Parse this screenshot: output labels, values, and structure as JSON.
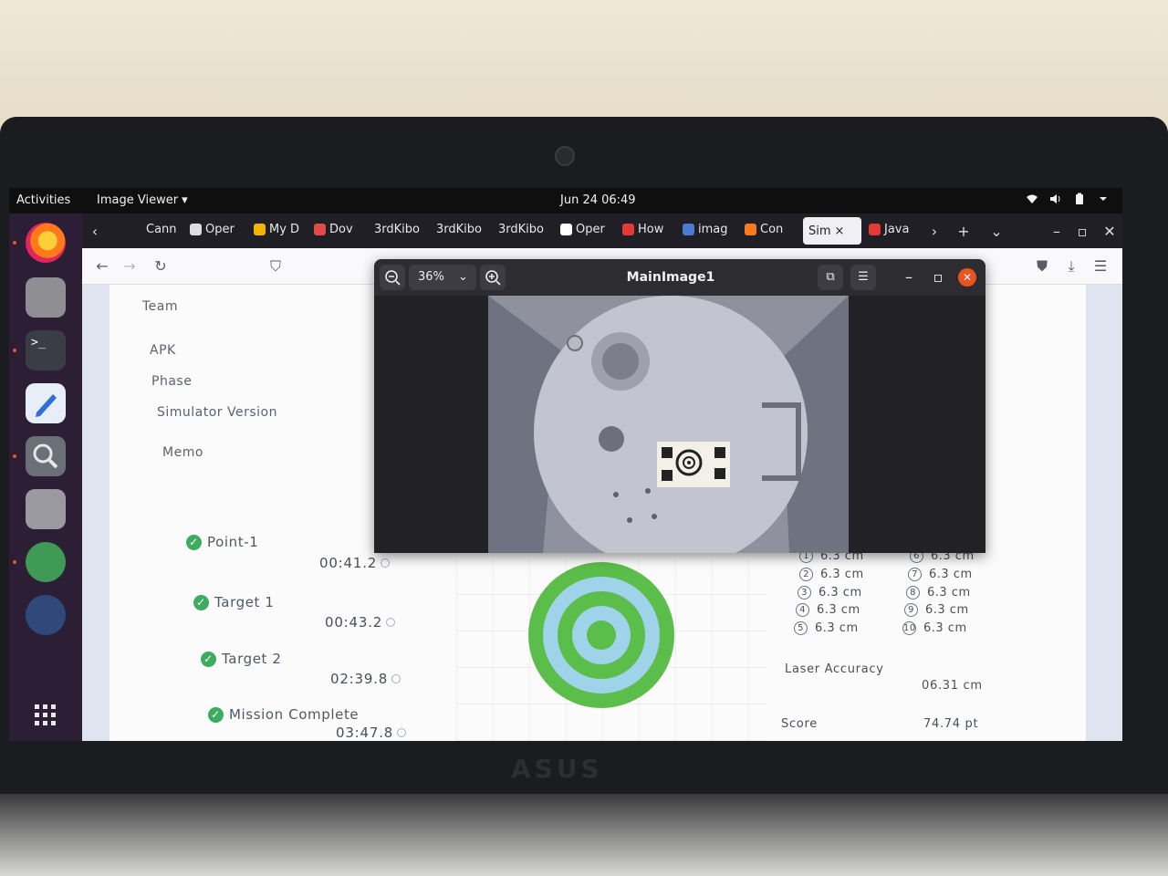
{
  "topbar": {
    "activities": "Activities",
    "app_menu": "Image Viewer ▾",
    "clock": "Jun 24  06:49"
  },
  "browser": {
    "tabs": [
      "Cann",
      "Oper",
      "My D",
      "Dov",
      "3rdKibo",
      "3rdKibo",
      "3rdKibo",
      "Oper",
      "How",
      "imag",
      "Con",
      "Sim",
      "Java"
    ]
  },
  "viewer": {
    "title": "MainImage1",
    "zoom": "36%"
  },
  "page": {
    "labels": {
      "team": "Team",
      "apk": "APK",
      "phase": "Phase",
      "simulator_version": "Simulator Version",
      "memo": "Memo"
    },
    "events": [
      {
        "name": "Point-1",
        "time": "00:41.2"
      },
      {
        "name": "Target 1",
        "time": "00:43.2"
      },
      {
        "name": "Target 2",
        "time": "02:39.8"
      },
      {
        "name": "Mission Complete",
        "time": "03:47.8"
      }
    ],
    "distances": [
      {
        "num": "1",
        "value": "6.3 cm"
      },
      {
        "num": "2",
        "value": "6.3 cm"
      },
      {
        "num": "3",
        "value": "6.3 cm"
      },
      {
        "num": "4",
        "value": "6.3 cm"
      },
      {
        "num": "5",
        "value": "6.3 cm"
      },
      {
        "num": "6",
        "value": "6.3 cm"
      },
      {
        "num": "7",
        "value": "6.3 cm"
      },
      {
        "num": "8",
        "value": "6.3 cm"
      },
      {
        "num": "9",
        "value": "6.3 cm"
      },
      {
        "num": "10",
        "value": "6.3 cm"
      }
    ],
    "laser_accuracy_label": "Laser Accuracy",
    "laser_accuracy_value": "06.31 cm",
    "score_label": "Score",
    "score_value": "74.74 pt"
  },
  "hardware": {
    "brand": "ASUS"
  },
  "colors": {
    "target_green": "#5bbd4a",
    "target_blue": "#9fd3ea",
    "check_green": "#3dab60",
    "dock_bg": "#2c1f35",
    "close_orange": "#e95420"
  }
}
